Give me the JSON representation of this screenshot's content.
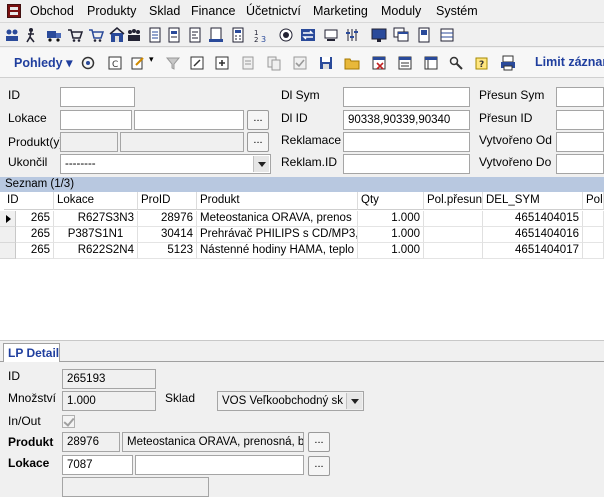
{
  "menubar": {
    "items": [
      "Obchod",
      "Produkty",
      "Sklad",
      "Finance",
      "Účetnictví",
      "Marketing",
      "Moduly",
      "Systém"
    ]
  },
  "toolbar2": {
    "views_label": "Pohledy",
    "limit_label": "Limit záznam"
  },
  "filter": {
    "id_label": "ID",
    "id_value": "",
    "lokace_label": "Lokace",
    "lokace_value": "",
    "lokace_value2": "",
    "produkty_label": "Produkt(y)",
    "produkty_value": "",
    "ukoncil_label": "Ukončil",
    "ukoncil_value": "--------",
    "dl_sym_label": "Dl Sym",
    "dl_sym_value": "",
    "dl_id_label": "Dl ID",
    "dl_id_value": "90338,90339,90340",
    "reklamace_label": "Reklamace",
    "reklamace_value": "",
    "reklam_id_label": "Reklam.ID",
    "reklam_id_value": "",
    "presun_sym_label": "Přesun Sym",
    "presun_id_label": "Přesun ID",
    "vytvoreno_od_label": "Vytvořeno Od",
    "vytvoreno_do_label": "Vytvořeno Do",
    "browse_label": "..."
  },
  "list": {
    "title": "Seznam (1/3)",
    "columns": [
      "ID",
      "Lokace",
      "ProID",
      "Produkt",
      "Qty",
      "Pol.přesun",
      "DEL_SYM",
      "Pol"
    ],
    "rows": [
      {
        "id": "265",
        "lokace": "R627S3N3",
        "proid": "28976",
        "produkt": "Meteostanica ORAVA, prenos",
        "qty": "1.000",
        "pol_presun": "",
        "del_sym": "4651404015",
        "pol": ""
      },
      {
        "id": "265",
        "lokace": "P387S1N1",
        "proid": "30414",
        "produkt": "Prehrávač PHILIPS s CD/MP3,",
        "qty": "1.000",
        "pol_presun": "",
        "del_sym": "4651404016",
        "pol": ""
      },
      {
        "id": "265",
        "lokace": "R622S2N4",
        "proid": "5123",
        "produkt": "Nástenné hodiny HAMA, teplo",
        "qty": "1.000",
        "pol_presun": "",
        "del_sym": "4651404017",
        "pol": ""
      }
    ]
  },
  "detail": {
    "tab_label": "LP Detail",
    "id_label": "ID",
    "id_value": "265193",
    "mnozstvi_label": "Množství",
    "mnozstvi_value": "1.000",
    "sklad_label": "Sklad",
    "sklad_value": "VOS Veľkoobchodný sk",
    "inout_label": "In/Out",
    "produkt_label": "Produkt",
    "produkt_id": "28976",
    "produkt_name": "Meteostanica ORAVA, prenosná, b",
    "lokace_label": "Lokace",
    "lokace_value": "7087",
    "lokace_value2": "",
    "browse_label": "..."
  },
  "colors": {
    "accent_blue": "#1f3e9e",
    "list_header_bg": "#b8c8e0",
    "app_icon": "#7a1010"
  }
}
